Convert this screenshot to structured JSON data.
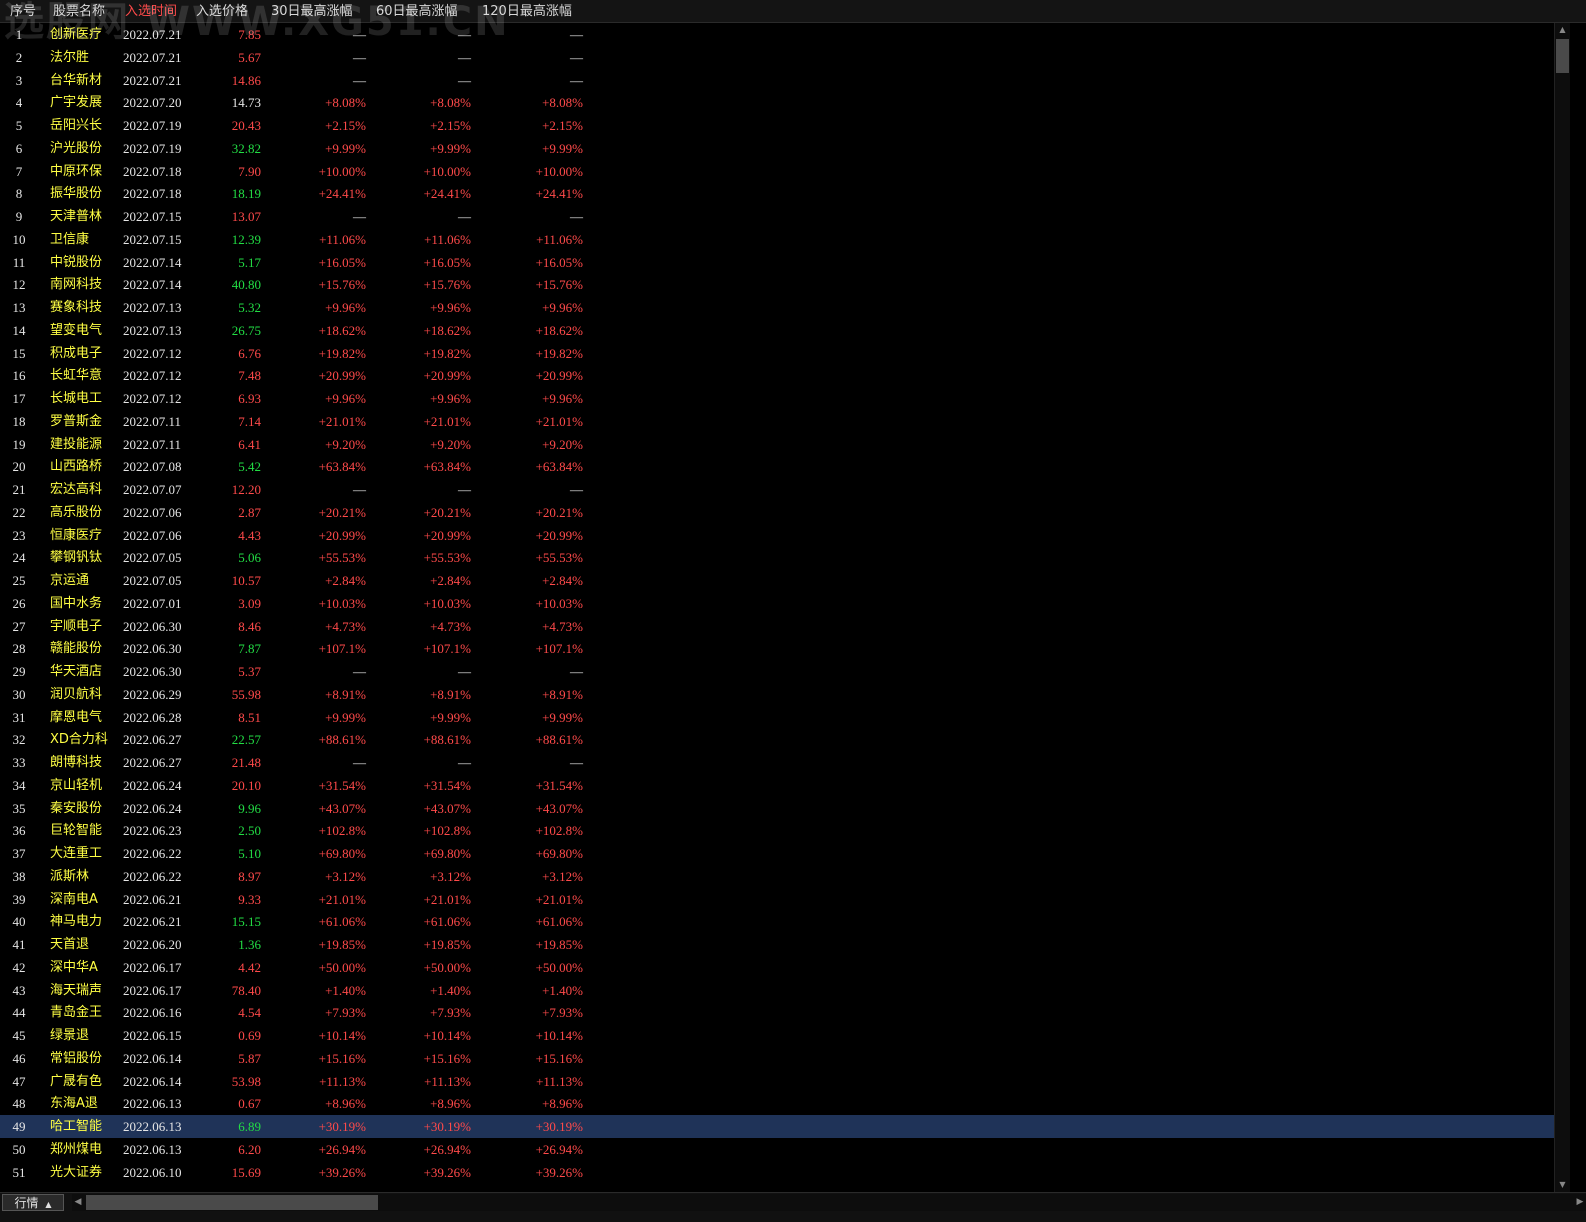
{
  "columns": [
    "序号",
    "股票名称",
    "入选时间",
    "入选价格",
    "30日最高涨幅",
    "60日最高涨幅",
    "120日最高涨幅"
  ],
  "sorted_column": 2,
  "watermark": "选股网 WWW.XG51.CN",
  "colors": {
    "up": "#ff4a4a",
    "down": "#22dd44",
    "flat": "#e6e6e6",
    "name": "#ffff44",
    "selected_row": "#1f3358"
  },
  "selected_row_index": 48,
  "rows": [
    {
      "idx": "1",
      "name": "创新医疗",
      "date": "2022.07.21",
      "price": "7.85",
      "price_dir": "up",
      "g30": "—",
      "g60": "—",
      "g120": "—"
    },
    {
      "idx": "2",
      "name": "法尔胜",
      "date": "2022.07.21",
      "price": "5.67",
      "price_dir": "up",
      "g30": "—",
      "g60": "—",
      "g120": "—"
    },
    {
      "idx": "3",
      "name": "台华新材",
      "date": "2022.07.21",
      "price": "14.86",
      "price_dir": "up",
      "g30": "—",
      "g60": "—",
      "g120": "—"
    },
    {
      "idx": "4",
      "name": "广宇发展",
      "date": "2022.07.20",
      "price": "14.73",
      "price_dir": "flat",
      "g30": "+8.08%",
      "g60": "+8.08%",
      "g120": "+8.08%"
    },
    {
      "idx": "5",
      "name": "岳阳兴长",
      "date": "2022.07.19",
      "price": "20.43",
      "price_dir": "up",
      "g30": "+2.15%",
      "g60": "+2.15%",
      "g120": "+2.15%"
    },
    {
      "idx": "6",
      "name": "沪光股份",
      "date": "2022.07.19",
      "price": "32.82",
      "price_dir": "down",
      "g30": "+9.99%",
      "g60": "+9.99%",
      "g120": "+9.99%"
    },
    {
      "idx": "7",
      "name": "中原环保",
      "date": "2022.07.18",
      "price": "7.90",
      "price_dir": "up",
      "g30": "+10.00%",
      "g60": "+10.00%",
      "g120": "+10.00%"
    },
    {
      "idx": "8",
      "name": "振华股份",
      "date": "2022.07.18",
      "price": "18.19",
      "price_dir": "down",
      "g30": "+24.41%",
      "g60": "+24.41%",
      "g120": "+24.41%"
    },
    {
      "idx": "9",
      "name": "天津普林",
      "date": "2022.07.15",
      "price": "13.07",
      "price_dir": "up",
      "g30": "—",
      "g60": "—",
      "g120": "—"
    },
    {
      "idx": "10",
      "name": "卫信康",
      "date": "2022.07.15",
      "price": "12.39",
      "price_dir": "down",
      "g30": "+11.06%",
      "g60": "+11.06%",
      "g120": "+11.06%"
    },
    {
      "idx": "11",
      "name": "中锐股份",
      "date": "2022.07.14",
      "price": "5.17",
      "price_dir": "down",
      "g30": "+16.05%",
      "g60": "+16.05%",
      "g120": "+16.05%"
    },
    {
      "idx": "12",
      "name": "南网科技",
      "date": "2022.07.14",
      "price": "40.80",
      "price_dir": "down",
      "g30": "+15.76%",
      "g60": "+15.76%",
      "g120": "+15.76%"
    },
    {
      "idx": "13",
      "name": "赛象科技",
      "date": "2022.07.13",
      "price": "5.32",
      "price_dir": "down",
      "g30": "+9.96%",
      "g60": "+9.96%",
      "g120": "+9.96%"
    },
    {
      "idx": "14",
      "name": "望变电气",
      "date": "2022.07.13",
      "price": "26.75",
      "price_dir": "down",
      "g30": "+18.62%",
      "g60": "+18.62%",
      "g120": "+18.62%"
    },
    {
      "idx": "15",
      "name": "积成电子",
      "date": "2022.07.12",
      "price": "6.76",
      "price_dir": "up",
      "g30": "+19.82%",
      "g60": "+19.82%",
      "g120": "+19.82%"
    },
    {
      "idx": "16",
      "name": "长虹华意",
      "date": "2022.07.12",
      "price": "7.48",
      "price_dir": "up",
      "g30": "+20.99%",
      "g60": "+20.99%",
      "g120": "+20.99%"
    },
    {
      "idx": "17",
      "name": "长城电工",
      "date": "2022.07.12",
      "price": "6.93",
      "price_dir": "up",
      "g30": "+9.96%",
      "g60": "+9.96%",
      "g120": "+9.96%"
    },
    {
      "idx": "18",
      "name": "罗普斯金",
      "date": "2022.07.11",
      "price": "7.14",
      "price_dir": "up",
      "g30": "+21.01%",
      "g60": "+21.01%",
      "g120": "+21.01%"
    },
    {
      "idx": "19",
      "name": "建投能源",
      "date": "2022.07.11",
      "price": "6.41",
      "price_dir": "up",
      "g30": "+9.20%",
      "g60": "+9.20%",
      "g120": "+9.20%"
    },
    {
      "idx": "20",
      "name": "山西路桥",
      "date": "2022.07.08",
      "price": "5.42",
      "price_dir": "down",
      "g30": "+63.84%",
      "g60": "+63.84%",
      "g120": "+63.84%"
    },
    {
      "idx": "21",
      "name": "宏达高科",
      "date": "2022.07.07",
      "price": "12.20",
      "price_dir": "up",
      "g30": "—",
      "g60": "—",
      "g120": "—"
    },
    {
      "idx": "22",
      "name": "高乐股份",
      "date": "2022.07.06",
      "price": "2.87",
      "price_dir": "up",
      "g30": "+20.21%",
      "g60": "+20.21%",
      "g120": "+20.21%"
    },
    {
      "idx": "23",
      "name": "恒康医疗",
      "date": "2022.07.06",
      "price": "4.43",
      "price_dir": "up",
      "g30": "+20.99%",
      "g60": "+20.99%",
      "g120": "+20.99%"
    },
    {
      "idx": "24",
      "name": "攀钢钒钛",
      "date": "2022.07.05",
      "price": "5.06",
      "price_dir": "down",
      "g30": "+55.53%",
      "g60": "+55.53%",
      "g120": "+55.53%"
    },
    {
      "idx": "25",
      "name": "京运通",
      "date": "2022.07.05",
      "price": "10.57",
      "price_dir": "up",
      "g30": "+2.84%",
      "g60": "+2.84%",
      "g120": "+2.84%"
    },
    {
      "idx": "26",
      "name": "国中水务",
      "date": "2022.07.01",
      "price": "3.09",
      "price_dir": "up",
      "g30": "+10.03%",
      "g60": "+10.03%",
      "g120": "+10.03%"
    },
    {
      "idx": "27",
      "name": "宇顺电子",
      "date": "2022.06.30",
      "price": "8.46",
      "price_dir": "up",
      "g30": "+4.73%",
      "g60": "+4.73%",
      "g120": "+4.73%"
    },
    {
      "idx": "28",
      "name": "赣能股份",
      "date": "2022.06.30",
      "price": "7.87",
      "price_dir": "down",
      "g30": "+107.1%",
      "g60": "+107.1%",
      "g120": "+107.1%"
    },
    {
      "idx": "29",
      "name": "华天酒店",
      "date": "2022.06.30",
      "price": "5.37",
      "price_dir": "up",
      "g30": "—",
      "g60": "—",
      "g120": "—"
    },
    {
      "idx": "30",
      "name": "润贝航科",
      "date": "2022.06.29",
      "price": "55.98",
      "price_dir": "up",
      "g30": "+8.91%",
      "g60": "+8.91%",
      "g120": "+8.91%"
    },
    {
      "idx": "31",
      "name": "摩恩电气",
      "date": "2022.06.28",
      "price": "8.51",
      "price_dir": "up",
      "g30": "+9.99%",
      "g60": "+9.99%",
      "g120": "+9.99%"
    },
    {
      "idx": "32",
      "name": "XD合力科",
      "date": "2022.06.27",
      "price": "22.57",
      "price_dir": "down",
      "g30": "+88.61%",
      "g60": "+88.61%",
      "g120": "+88.61%"
    },
    {
      "idx": "33",
      "name": "朗博科技",
      "date": "2022.06.27",
      "price": "21.48",
      "price_dir": "up",
      "g30": "—",
      "g60": "—",
      "g120": "—"
    },
    {
      "idx": "34",
      "name": "京山轻机",
      "date": "2022.06.24",
      "price": "20.10",
      "price_dir": "up",
      "g30": "+31.54%",
      "g60": "+31.54%",
      "g120": "+31.54%"
    },
    {
      "idx": "35",
      "name": "秦安股份",
      "date": "2022.06.24",
      "price": "9.96",
      "price_dir": "down",
      "g30": "+43.07%",
      "g60": "+43.07%",
      "g120": "+43.07%"
    },
    {
      "idx": "36",
      "name": "巨轮智能",
      "date": "2022.06.23",
      "price": "2.50",
      "price_dir": "down",
      "g30": "+102.8%",
      "g60": "+102.8%",
      "g120": "+102.8%"
    },
    {
      "idx": "37",
      "name": "大连重工",
      "date": "2022.06.22",
      "price": "5.10",
      "price_dir": "down",
      "g30": "+69.80%",
      "g60": "+69.80%",
      "g120": "+69.80%"
    },
    {
      "idx": "38",
      "name": "派斯林",
      "date": "2022.06.22",
      "price": "8.97",
      "price_dir": "up",
      "g30": "+3.12%",
      "g60": "+3.12%",
      "g120": "+3.12%"
    },
    {
      "idx": "39",
      "name": "深南电A",
      "date": "2022.06.21",
      "price": "9.33",
      "price_dir": "up",
      "g30": "+21.01%",
      "g60": "+21.01%",
      "g120": "+21.01%"
    },
    {
      "idx": "40",
      "name": "神马电力",
      "date": "2022.06.21",
      "price": "15.15",
      "price_dir": "down",
      "g30": "+61.06%",
      "g60": "+61.06%",
      "g120": "+61.06%"
    },
    {
      "idx": "41",
      "name": "天首退",
      "date": "2022.06.20",
      "price": "1.36",
      "price_dir": "down",
      "g30": "+19.85%",
      "g60": "+19.85%",
      "g120": "+19.85%"
    },
    {
      "idx": "42",
      "name": "深中华A",
      "date": "2022.06.17",
      "price": "4.42",
      "price_dir": "up",
      "g30": "+50.00%",
      "g60": "+50.00%",
      "g120": "+50.00%"
    },
    {
      "idx": "43",
      "name": "海天瑞声",
      "date": "2022.06.17",
      "price": "78.40",
      "price_dir": "up",
      "g30": "+1.40%",
      "g60": "+1.40%",
      "g120": "+1.40%"
    },
    {
      "idx": "44",
      "name": "青岛金王",
      "date": "2022.06.16",
      "price": "4.54",
      "price_dir": "up",
      "g30": "+7.93%",
      "g60": "+7.93%",
      "g120": "+7.93%"
    },
    {
      "idx": "45",
      "name": "绿景退",
      "date": "2022.06.15",
      "price": "0.69",
      "price_dir": "up",
      "g30": "+10.14%",
      "g60": "+10.14%",
      "g120": "+10.14%"
    },
    {
      "idx": "46",
      "name": "常铝股份",
      "date": "2022.06.14",
      "price": "5.87",
      "price_dir": "up",
      "g30": "+15.16%",
      "g60": "+15.16%",
      "g120": "+15.16%"
    },
    {
      "idx": "47",
      "name": "广晟有色",
      "date": "2022.06.14",
      "price": "53.98",
      "price_dir": "up",
      "g30": "+11.13%",
      "g60": "+11.13%",
      "g120": "+11.13%"
    },
    {
      "idx": "48",
      "name": "东海A退",
      "date": "2022.06.13",
      "price": "0.67",
      "price_dir": "up",
      "g30": "+8.96%",
      "g60": "+8.96%",
      "g120": "+8.96%"
    },
    {
      "idx": "49",
      "name": "哈工智能",
      "date": "2022.06.13",
      "price": "6.89",
      "price_dir": "down",
      "g30": "+30.19%",
      "g60": "+30.19%",
      "g120": "+30.19%"
    },
    {
      "idx": "50",
      "name": "郑州煤电",
      "date": "2022.06.13",
      "price": "6.20",
      "price_dir": "up",
      "g30": "+26.94%",
      "g60": "+26.94%",
      "g120": "+26.94%"
    },
    {
      "idx": "51",
      "name": "光大证券",
      "date": "2022.06.10",
      "price": "15.69",
      "price_dir": "up",
      "g30": "+39.26%",
      "g60": "+39.26%",
      "g120": "+39.26%"
    }
  ],
  "bottom_tab": {
    "label": "行情",
    "icon": "caret-up-icon"
  }
}
